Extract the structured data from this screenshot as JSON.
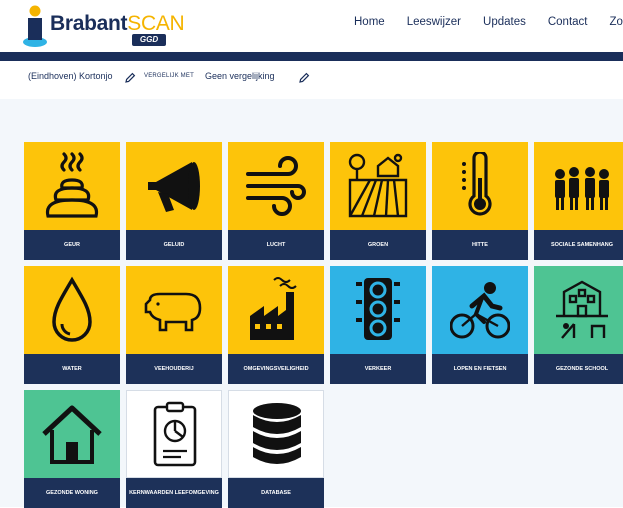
{
  "header": {
    "logo_brand": "Brabant",
    "logo_scan": "SCAN",
    "logo_badge": "GGD",
    "nav": [
      "Home",
      "Leeswijzer",
      "Updates",
      "Contact",
      "Zoeken"
    ]
  },
  "filter": {
    "region": "(Eindhoven) Kortonjo",
    "compare_label": "VERGELIJK MET",
    "compare_value": "Geen vergelijking"
  },
  "colors": {
    "navy": "#1d3159",
    "yellow": "#fdc40a",
    "blue": "#2fb3e5",
    "green": "#4ec493"
  },
  "tiles": [
    {
      "label": "GEUR",
      "icon": "poop-icon"
    },
    {
      "label": "GELUID",
      "icon": "megaphone-icon"
    },
    {
      "label": "LUCHT",
      "icon": "wind-icon"
    },
    {
      "label": "GROEN",
      "icon": "farm-field-icon"
    },
    {
      "label": "HITTE",
      "icon": "thermometer-icon"
    },
    {
      "label": "SOCIALE SAMENHANG",
      "icon": "people-group-icon"
    },
    {
      "label": "WATER",
      "icon": "water-drop-icon"
    },
    {
      "label": "VEEHOUDERIJ",
      "icon": "pig-icon"
    },
    {
      "label": "OMGEVINGSVEILIGHEID",
      "icon": "factory-icon"
    },
    {
      "label": "VERKEER",
      "icon": "traffic-light-icon"
    },
    {
      "label": "LOPEN EN FIETSEN",
      "icon": "cyclist-icon"
    },
    {
      "label": "GEZONDE SCHOOL",
      "icon": "school-icon"
    },
    {
      "label": "GEZONDE WONING",
      "icon": "house-icon"
    },
    {
      "label": "KERNWAARDEN LEEFOMGEVING",
      "icon": "clipboard-chart-icon"
    },
    {
      "label": "DATABASE",
      "icon": "database-icon"
    }
  ]
}
